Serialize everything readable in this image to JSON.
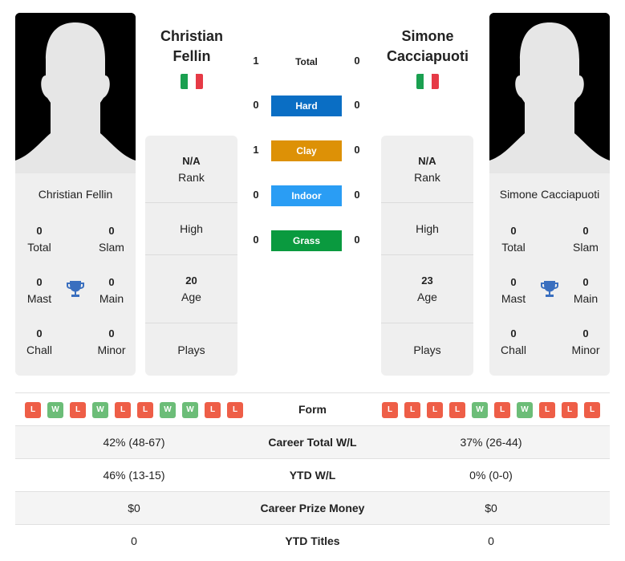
{
  "players": [
    {
      "name": "Christian Fellin",
      "title_line1": "Christian",
      "title_line2": "Fellin",
      "flag": [
        "#1aa050",
        "#ffffff",
        "#e63a46"
      ],
      "titles": {
        "total": "0",
        "slam": "0",
        "mast": "0",
        "main": "0",
        "chall": "0",
        "minor": "0"
      },
      "info": {
        "rank": "N/A",
        "high": "",
        "age": "20",
        "plays": ""
      },
      "form": [
        "L",
        "W",
        "L",
        "W",
        "L",
        "L",
        "W",
        "W",
        "L",
        "L"
      ],
      "career_wl": "42% (48-67)",
      "ytd_wl": "46% (13-15)",
      "prize": "$0",
      "ytd_titles": "0"
    },
    {
      "name": "Simone Cacciapuoti",
      "title_line1": "Simone",
      "title_line2": "Cacciapuoti",
      "flag": [
        "#1aa050",
        "#ffffff",
        "#e63a46"
      ],
      "titles": {
        "total": "0",
        "slam": "0",
        "mast": "0",
        "main": "0",
        "chall": "0",
        "minor": "0"
      },
      "info": {
        "rank": "N/A",
        "high": "",
        "age": "23",
        "plays": ""
      },
      "form": [
        "L",
        "L",
        "L",
        "L",
        "W",
        "L",
        "W",
        "L",
        "L",
        "L"
      ],
      "career_wl": "37% (26-44)",
      "ytd_wl": "0% (0-0)",
      "prize": "$0",
      "ytd_titles": "0"
    }
  ],
  "labels": {
    "total": "Total",
    "slam": "Slam",
    "mast": "Mast",
    "main": "Main",
    "chall": "Chall",
    "minor": "Minor",
    "rank": "Rank",
    "high": "High",
    "age": "Age",
    "plays": "Plays",
    "form": "Form",
    "career_wl": "Career Total W/L",
    "ytd_wl": "YTD W/L",
    "prize": "Career Prize Money",
    "ytd_titles": "YTD Titles"
  },
  "h2h": [
    {
      "label": "Total",
      "left": "1",
      "right": "0",
      "color": ""
    },
    {
      "label": "Hard",
      "left": "0",
      "right": "0",
      "color": "#0a6ec4"
    },
    {
      "label": "Clay",
      "left": "1",
      "right": "0",
      "color": "#dd9106"
    },
    {
      "label": "Indoor",
      "left": "0",
      "right": "0",
      "color": "#2a9df4"
    },
    {
      "label": "Grass",
      "left": "0",
      "right": "0",
      "color": "#0a9a3f"
    }
  ],
  "colors": {
    "win": "#6cbd78",
    "loss": "#ee5e47",
    "trophy": "#3a6fbf"
  }
}
